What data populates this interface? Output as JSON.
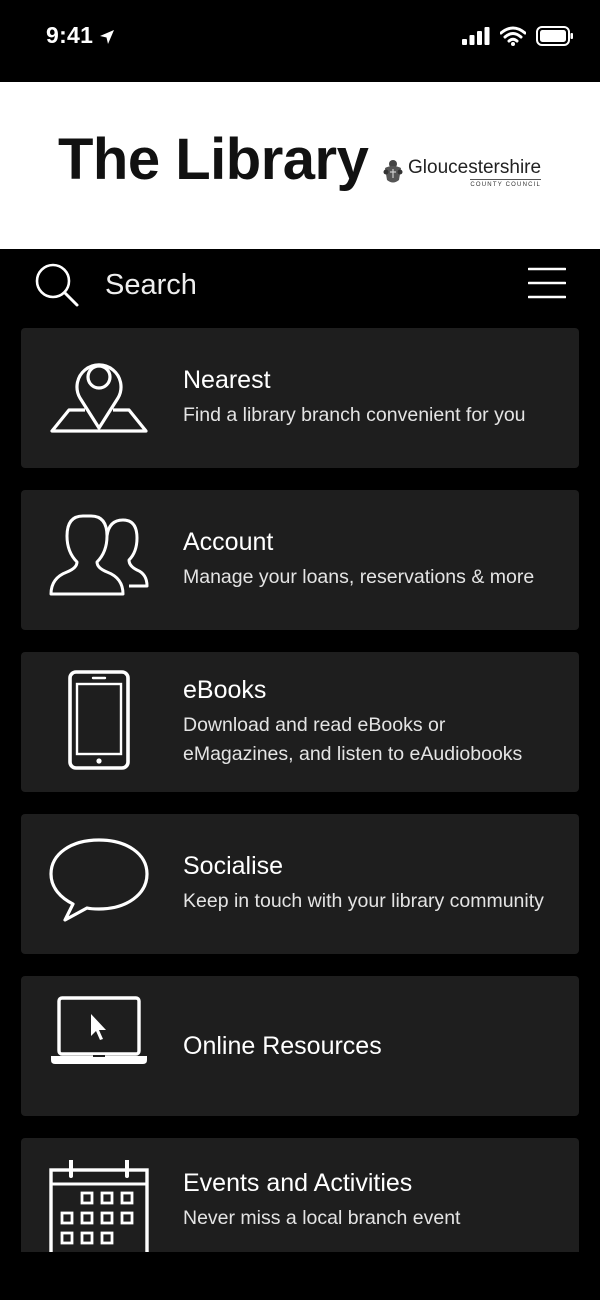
{
  "status_bar": {
    "time": "9:41"
  },
  "header": {
    "title": "The Library",
    "council_name": "Gloucestershire",
    "council_sub": "COUNTY COUNCIL"
  },
  "search": {
    "label": "Search"
  },
  "tiles": [
    {
      "icon": "map-pin-icon",
      "title": "Nearest",
      "desc": "Find a library branch convenient for you"
    },
    {
      "icon": "users-icon",
      "title": "Account",
      "desc": "Manage your loans, reservations & more"
    },
    {
      "icon": "phone-icon",
      "title": "eBooks",
      "desc": "Download and read eBooks or eMagazines, and listen to eAudiobooks"
    },
    {
      "icon": "speech-bubble-icon",
      "title": "Socialise",
      "desc": "Keep in touch with your library community"
    },
    {
      "icon": "laptop-icon",
      "title": "Online Resources",
      "desc": ""
    },
    {
      "icon": "calendar-icon",
      "title": "Events and Activities",
      "desc": "Never miss a local branch event"
    }
  ],
  "colors": {
    "background": "#000000",
    "tile": "#1e1e1e",
    "header": "#ffffff",
    "text": "#ffffff"
  }
}
